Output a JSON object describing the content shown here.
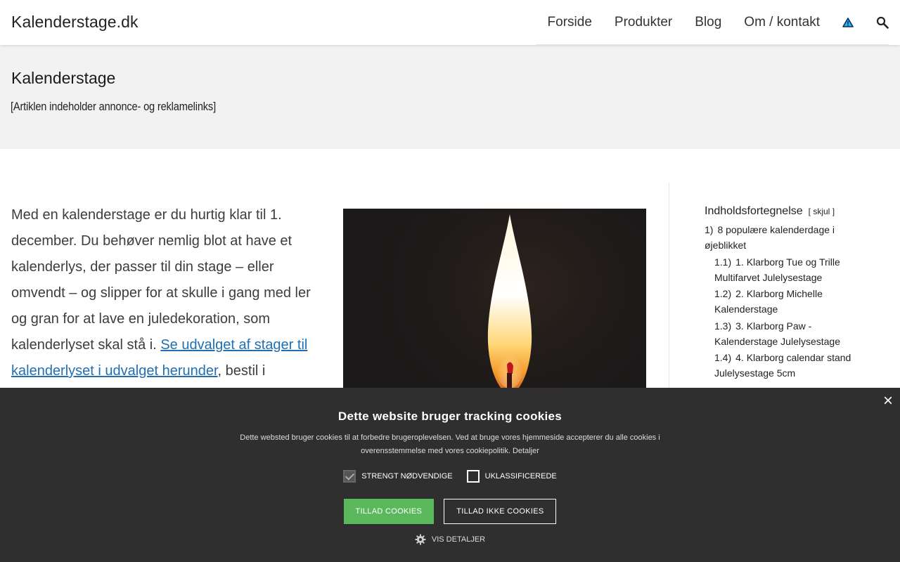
{
  "header": {
    "site_name": "Kalenderstage.dk",
    "nav": [
      "Forside",
      "Produkter",
      "Blog",
      "Om / kontakt"
    ]
  },
  "title_band": {
    "title": "Kalenderstage",
    "disclaimer": "[Artiklen indeholder annonce- og reklamelinks]"
  },
  "intro": {
    "text_before": "Med en kalenderstage er du hurtig klar til 1. december. Du behøver nemlig blot at have et kalenderlys, der passer til din stage – eller omvendt – og slipper for at skulle i gang med ler og gran for at lave en juledekoration, som kalenderlyset skal stå i. ",
    "link": "Se udvalget af stager til kalenderlyset i udvalget herunder",
    "text_after": ", bestil i"
  },
  "toc": {
    "heading": "Indholdsfortegnelse",
    "toggle_open": "[",
    "toggle_label": "skjul",
    "toggle_close": "]",
    "items": [
      {
        "num": "1)",
        "label": "8 populære kalenderdage i øjeblikket",
        "level": 1
      },
      {
        "num": "1.1)",
        "label": "1. Klarborg Tue og Trille Multifarvet Julelysestage",
        "level": 2
      },
      {
        "num": "1.2)",
        "label": "2. Klarborg Michelle Kalenderstage",
        "level": 2
      },
      {
        "num": "1.3)",
        "label": "3. Klarborg Paw - Kalenderstage Julelysestage",
        "level": 2
      },
      {
        "num": "1.4)",
        "label": "4. Klarborg calendar stand Julelysestage 5cm",
        "level": 2
      }
    ]
  },
  "cookie": {
    "close": "×",
    "title": "Dette website bruger tracking cookies",
    "description": "Dette websted bruger cookies til at forbedre brugeroplevelsen. Ved at bruge vores hjemmeside accepterer du alle cookies i overensstemmelse med vores cookiepolitik.",
    "details_link": "Detaljer",
    "check_necessary": "STRENGT NØDVENDIGE",
    "check_unclassified": "UKLASSIFICEREDE",
    "allow_btn": "TILLAD COOKIES",
    "deny_btn": "TILLAD IKKE COOKIES",
    "show_details": "VIS DETALJER"
  },
  "colors": {
    "link": "#1f6fb2",
    "cookie_bg": "#2f2f2f",
    "allow_btn": "#5cb85c",
    "title_band_bg": "#f2f2f2"
  },
  "icons": [
    "warning-triangle-icon",
    "search-icon",
    "gear-icon",
    "close-icon"
  ]
}
